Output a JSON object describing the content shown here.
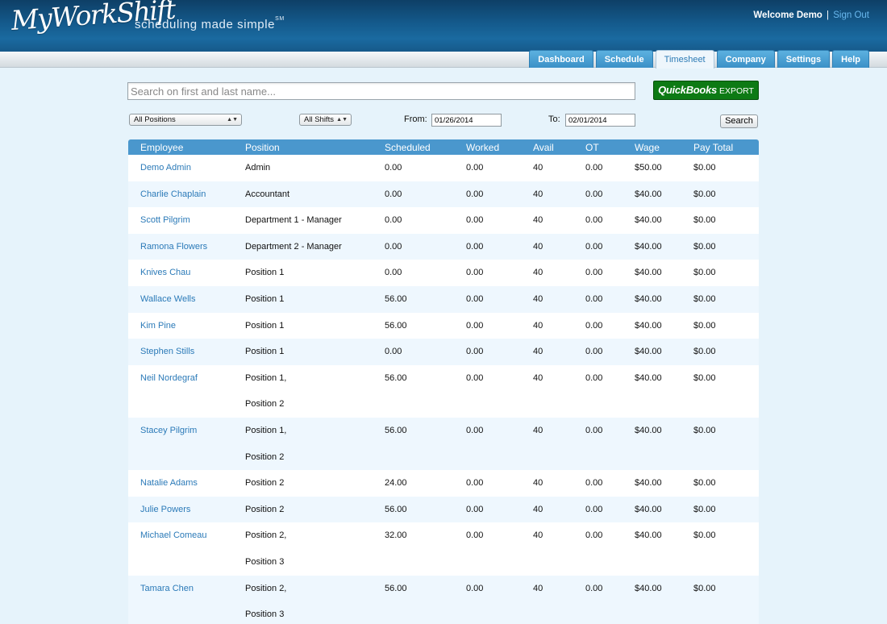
{
  "header": {
    "logo": "MyWorkShift",
    "tagline": "scheduling made simple",
    "tagline_mark": "SM",
    "welcome": "Welcome Demo",
    "separator": "|",
    "signout": "Sign Out"
  },
  "nav": {
    "tabs": [
      {
        "label": "Dashboard",
        "active": false
      },
      {
        "label": "Schedule",
        "active": false
      },
      {
        "label": "Timesheet",
        "active": true
      },
      {
        "label": "Company",
        "active": false
      },
      {
        "label": "Settings",
        "active": false
      },
      {
        "label": "Help",
        "active": false
      }
    ]
  },
  "search": {
    "placeholder": "Search on first and last name...",
    "value": ""
  },
  "quickbooks": {
    "brand": "QuickBooks",
    "label": "EXPORT"
  },
  "filters": {
    "positions": "All Positions",
    "shifts": "All Shifts",
    "from_label": "From:",
    "from_value": "01/26/2014",
    "to_label": "To:",
    "to_value": "02/01/2014",
    "search_button": "Search"
  },
  "table": {
    "columns": [
      "Employee",
      "Position",
      "Scheduled",
      "Worked",
      "Avail",
      "OT",
      "Wage",
      "Pay Total"
    ],
    "rows": [
      {
        "employee": "Demo Admin",
        "positions": [
          "Admin"
        ],
        "scheduled": "0.00",
        "worked": "0.00",
        "avail": "40",
        "ot": "0.00",
        "wage": "$50.00",
        "pay_total": "$0.00"
      },
      {
        "employee": "Charlie Chaplain",
        "positions": [
          "Accountant"
        ],
        "scheduled": "0.00",
        "worked": "0.00",
        "avail": "40",
        "ot": "0.00",
        "wage": "$40.00",
        "pay_total": "$0.00"
      },
      {
        "employee": "Scott Pilgrim",
        "positions": [
          "Department 1 - Manager"
        ],
        "scheduled": "0.00",
        "worked": "0.00",
        "avail": "40",
        "ot": "0.00",
        "wage": "$40.00",
        "pay_total": "$0.00"
      },
      {
        "employee": "Ramona Flowers",
        "positions": [
          "Department 2 - Manager"
        ],
        "scheduled": "0.00",
        "worked": "0.00",
        "avail": "40",
        "ot": "0.00",
        "wage": "$40.00",
        "pay_total": "$0.00"
      },
      {
        "employee": "Knives Chau",
        "positions": [
          "Position 1"
        ],
        "scheduled": "0.00",
        "worked": "0.00",
        "avail": "40",
        "ot": "0.00",
        "wage": "$40.00",
        "pay_total": "$0.00"
      },
      {
        "employee": "Wallace Wells",
        "positions": [
          "Position 1"
        ],
        "scheduled": "56.00",
        "worked": "0.00",
        "avail": "40",
        "ot": "0.00",
        "wage": "$40.00",
        "pay_total": "$0.00"
      },
      {
        "employee": "Kim Pine",
        "positions": [
          "Position 1"
        ],
        "scheduled": "56.00",
        "worked": "0.00",
        "avail": "40",
        "ot": "0.00",
        "wage": "$40.00",
        "pay_total": "$0.00"
      },
      {
        "employee": "Stephen Stills",
        "positions": [
          "Position 1"
        ],
        "scheduled": "0.00",
        "worked": "0.00",
        "avail": "40",
        "ot": "0.00",
        "wage": "$40.00",
        "pay_total": "$0.00"
      },
      {
        "employee": "Neil Nordegraf",
        "positions": [
          "Position 1,",
          "Position 2"
        ],
        "scheduled": "56.00",
        "worked": "0.00",
        "avail": "40",
        "ot": "0.00",
        "wage": "$40.00",
        "pay_total": "$0.00"
      },
      {
        "employee": "Stacey Pilgrim",
        "positions": [
          "Position 1,",
          "Position 2"
        ],
        "scheduled": "56.00",
        "worked": "0.00",
        "avail": "40",
        "ot": "0.00",
        "wage": "$40.00",
        "pay_total": "$0.00"
      },
      {
        "employee": "Natalie Adams",
        "positions": [
          "Position 2"
        ],
        "scheduled": "24.00",
        "worked": "0.00",
        "avail": "40",
        "ot": "0.00",
        "wage": "$40.00",
        "pay_total": "$0.00"
      },
      {
        "employee": "Julie Powers",
        "positions": [
          "Position 2"
        ],
        "scheduled": "56.00",
        "worked": "0.00",
        "avail": "40",
        "ot": "0.00",
        "wage": "$40.00",
        "pay_total": "$0.00"
      },
      {
        "employee": "Michael Comeau",
        "positions": [
          "Position 2,",
          "Position 3"
        ],
        "scheduled": "32.00",
        "worked": "0.00",
        "avail": "40",
        "ot": "0.00",
        "wage": "$40.00",
        "pay_total": "$0.00"
      },
      {
        "employee": "Tamara Chen",
        "positions": [
          "Position 2,",
          "Position 3"
        ],
        "scheduled": "56.00",
        "worked": "0.00",
        "avail": "40",
        "ot": "0.00",
        "wage": "$40.00",
        "pay_total": "$0.00"
      }
    ]
  },
  "colors": {
    "header_bg": "#145a8c",
    "tab_bg": "#3b90c7",
    "table_header_bg": "#4a97cd",
    "link": "#2b7ab8",
    "quickbooks_green": "#0d7a14",
    "page_bg": "#e6f3fb"
  }
}
